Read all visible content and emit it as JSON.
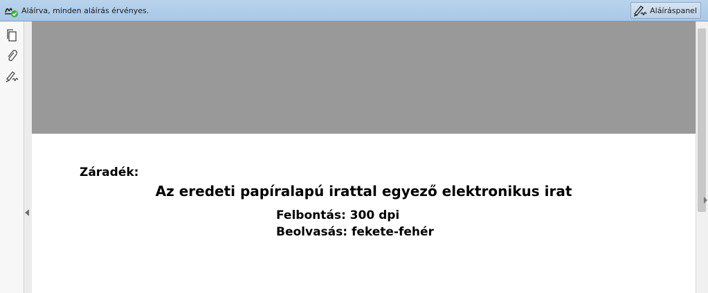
{
  "signature_bar": {
    "status_text": "Aláírva, minden aláírás érvényes.",
    "status_icon": "signature-valid-icon",
    "panel_button_label": "Aláíráspanel",
    "panel_button_icon": "signature-pen-icon"
  },
  "nav_pane": {
    "buttons": [
      {
        "icon": "pages-icon"
      },
      {
        "icon": "attachment-icon"
      },
      {
        "icon": "signature-icon"
      }
    ]
  },
  "document": {
    "label": "Záradék:",
    "heading": "Az eredeti papíralapú irattal egyező elektronikus irat",
    "resolution": "Felbontás: 300 dpi",
    "scan_mode": "Beolvasás: fekete-fehér"
  },
  "colors": {
    "signature_bar_bg": "#b9d3ec",
    "valid_green": "#3cae3c",
    "page_header_gray": "#999999"
  }
}
